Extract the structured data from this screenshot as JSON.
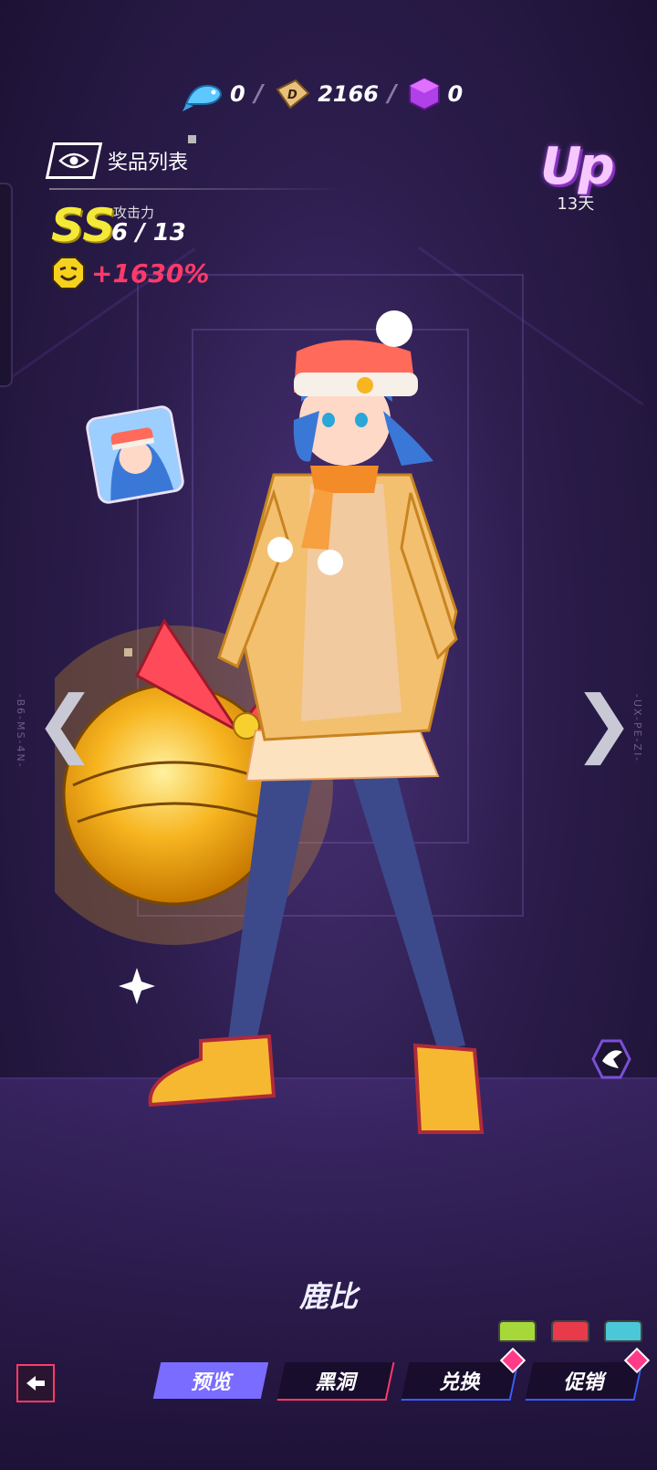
{
  "currency": [
    {
      "icon": "fish-icon",
      "value": "0"
    },
    {
      "icon": "dice-icon",
      "value": "2166"
    },
    {
      "icon": "cube-icon",
      "value": "0"
    }
  ],
  "prize_list": {
    "label": "奖品列表"
  },
  "stats": {
    "rank": "SS",
    "attack_label": "攻击力",
    "attack_value": "6 / 13",
    "bonus": "+1630%"
  },
  "up_badge": {
    "text": "Up",
    "days": "13天"
  },
  "side_codes": {
    "left": "-B6-MS-4N-",
    "right": "-UX-PE-ZI-"
  },
  "character": {
    "name": "鹿比"
  },
  "tabs": [
    {
      "label": "预览",
      "active": true
    },
    {
      "label": "黑洞",
      "active": false
    },
    {
      "label": "兑换",
      "active": false
    },
    {
      "label": "促销",
      "active": false
    }
  ],
  "colors": {
    "accent_pink": "#ff3a6a",
    "accent_blue": "#3c5cff",
    "active_tab": "#7a6cff",
    "rank_yellow": "#f4e838"
  }
}
